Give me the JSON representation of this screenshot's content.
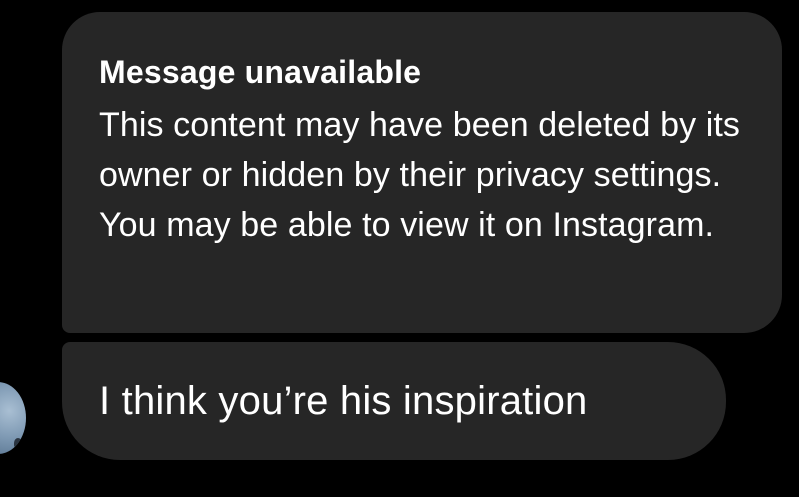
{
  "thread": {
    "messages": [
      {
        "type": "unavailable",
        "title": "Message unavailable",
        "body": "This content may have been deleted by its owner or hidden by their privacy settings. You may be able to view it on Instagram."
      },
      {
        "type": "text",
        "text": "I think you’re his inspiration"
      }
    ],
    "sender": {
      "avatar_icon": "profile-photo-avatar"
    }
  },
  "colors": {
    "background": "#000000",
    "bubble": "#262626",
    "text": "#ffffff"
  }
}
